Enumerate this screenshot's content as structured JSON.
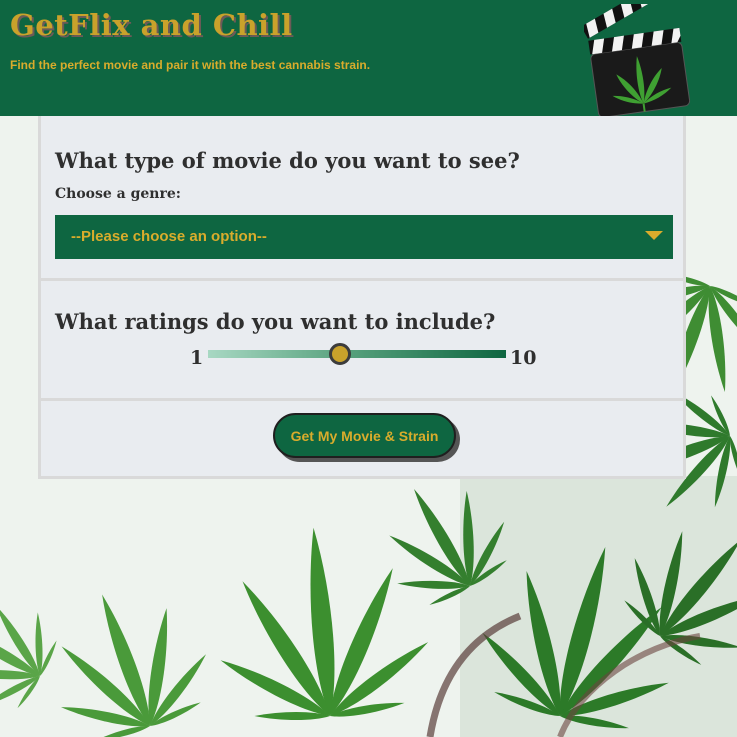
{
  "header": {
    "title": "GetFlix and Chill",
    "tagline": "Find the perfect movie and pair it with the best cannabis strain.",
    "logo_icon": "clapperboard-cannabis-icon"
  },
  "genre_section": {
    "question": "What type of movie do you want to see?",
    "label": "Choose a genre:",
    "select_value": "--Please choose an option--"
  },
  "rating_section": {
    "question": "What ratings do you want to include?",
    "min_label": "1",
    "max_label": "10",
    "slider_value": 5
  },
  "submit": {
    "label": "Get My Movie & Strain"
  },
  "colors": {
    "brand_green": "#0e6641",
    "gold": "#c9a22b",
    "panel": "#e9ecf0"
  }
}
